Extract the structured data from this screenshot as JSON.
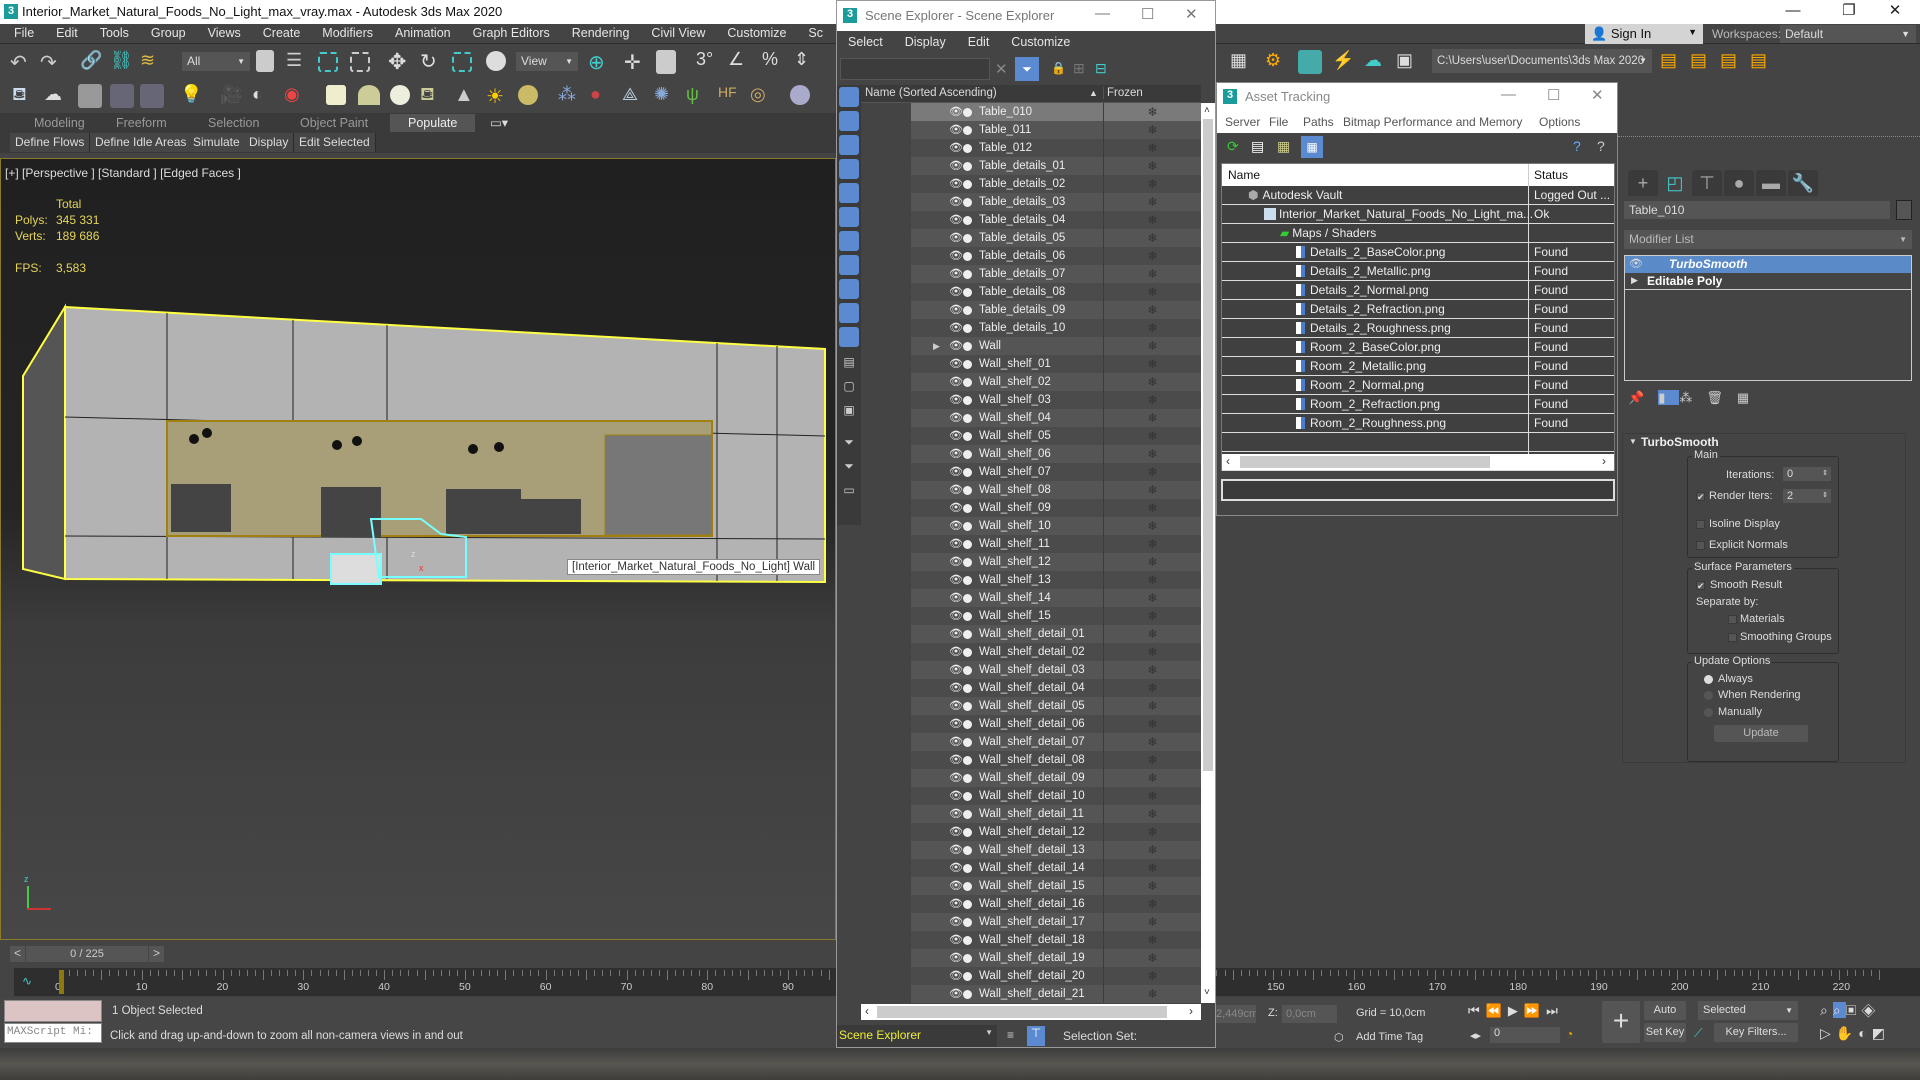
{
  "app": {
    "title": "Interior_Market_Natural_Foods_No_Light_max_vray.max - Autodesk 3ds Max 2020",
    "window_controls": {
      "minimize": "—",
      "restore": "❐",
      "close": "✕"
    }
  },
  "menubar": [
    "File",
    "Edit",
    "Tools",
    "Group",
    "Views",
    "Create",
    "Modifiers",
    "Animation",
    "Graph Editors",
    "Rendering",
    "Civil View",
    "Customize",
    "Sc"
  ],
  "toolbar": {
    "selection_filter": "All",
    "ref_coord": "View",
    "project_path": "C:\\Users\\user\\Documents\\3ds Max 2020",
    "sign_in": "Sign In",
    "workspaces_label": "Workspaces:",
    "workspace": "Default"
  },
  "ribbon": {
    "tabs": [
      "Modeling",
      "Freeform",
      "Selection",
      "Object Paint",
      "Populate"
    ],
    "active_tab": "Populate",
    "subtabs": [
      "Define Flows",
      "Define Idle Areas",
      "Simulate",
      "Display",
      "Edit Selected"
    ]
  },
  "viewport": {
    "label": "[+] [Perspective ] [Standard ] [Edged Faces ]",
    "stats_header": "Total",
    "polys_label": "Polys:",
    "polys": "345 331",
    "verts_label": "Verts:",
    "verts": "189 686",
    "fps_label": "FPS:",
    "fps": "3,583",
    "tooltip": "[Interior_Market_Natural_Foods_No_Light] Wall",
    "axis_z": "z",
    "axis_x": "x",
    "axis_y": "y"
  },
  "scene_explorer": {
    "title": "Scene Explorer - Scene Explorer",
    "menu": [
      "Select",
      "Display",
      "Edit",
      "Customize"
    ],
    "col_name": "Name (Sorted Ascending)",
    "col_frozen": "Frozen",
    "rows": [
      "Table_010",
      "Table_011",
      "Table_012",
      "Table_details_01",
      "Table_details_02",
      "Table_details_03",
      "Table_details_04",
      "Table_details_05",
      "Table_details_06",
      "Table_details_07",
      "Table_details_08",
      "Table_details_09",
      "Table_details_10",
      "Wall",
      "Wall_shelf_01",
      "Wall_shelf_02",
      "Wall_shelf_03",
      "Wall_shelf_04",
      "Wall_shelf_05",
      "Wall_shelf_06",
      "Wall_shelf_07",
      "Wall_shelf_08",
      "Wall_shelf_09",
      "Wall_shelf_10",
      "Wall_shelf_11",
      "Wall_shelf_12",
      "Wall_shelf_13",
      "Wall_shelf_14",
      "Wall_shelf_15",
      "Wall_shelf_detail_01",
      "Wall_shelf_detail_02",
      "Wall_shelf_detail_03",
      "Wall_shelf_detail_04",
      "Wall_shelf_detail_05",
      "Wall_shelf_detail_06",
      "Wall_shelf_detail_07",
      "Wall_shelf_detail_08",
      "Wall_shelf_detail_09",
      "Wall_shelf_detail_10",
      "Wall_shelf_detail_11",
      "Wall_shelf_detail_12",
      "Wall_shelf_detail_13",
      "Wall_shelf_detail_14",
      "Wall_shelf_detail_15",
      "Wall_shelf_detail_16",
      "Wall_shelf_detail_17",
      "Wall_shelf_detail_18",
      "Wall_shelf_detail_19",
      "Wall_shelf_detail_20",
      "Wall_shelf_detail_21"
    ],
    "selected": "Table_010",
    "expandable": "Wall",
    "footer_dropdown": "Scene Explorer",
    "selection_set_label": "Selection Set:"
  },
  "asset_tracking": {
    "title": "Asset Tracking",
    "menu": [
      "Server",
      "File",
      "Paths",
      "Bitmap Performance and Memory",
      "Options"
    ],
    "col_name": "Name",
    "col_status": "Status",
    "rows": [
      {
        "name": "Autodesk Vault",
        "status": "Logged Out ...",
        "level": 0,
        "icon": "vault-icon"
      },
      {
        "name": "Interior_Market_Natural_Foods_No_Light_ma...",
        "status": "Ok",
        "level": 1,
        "icon": "max-file-icon"
      },
      {
        "name": "Maps / Shaders",
        "status": "",
        "level": 2,
        "icon": "maps-icon"
      },
      {
        "name": "Details_2_BaseColor.png",
        "status": "Found",
        "level": 3,
        "icon": "image-file-icon"
      },
      {
        "name": "Details_2_Metallic.png",
        "status": "Found",
        "level": 3,
        "icon": "image-file-icon"
      },
      {
        "name": "Details_2_Normal.png",
        "status": "Found",
        "level": 3,
        "icon": "image-file-icon"
      },
      {
        "name": "Details_2_Refraction.png",
        "status": "Found",
        "level": 3,
        "icon": "image-file-icon"
      },
      {
        "name": "Details_2_Roughness.png",
        "status": "Found",
        "level": 3,
        "icon": "image-file-icon"
      },
      {
        "name": "Room_2_BaseColor.png",
        "status": "Found",
        "level": 3,
        "icon": "image-file-icon"
      },
      {
        "name": "Room_2_Metallic.png",
        "status": "Found",
        "level": 3,
        "icon": "image-file-icon"
      },
      {
        "name": "Room_2_Normal.png",
        "status": "Found",
        "level": 3,
        "icon": "image-file-icon"
      },
      {
        "name": "Room_2_Refraction.png",
        "status": "Found",
        "level": 3,
        "icon": "image-file-icon"
      },
      {
        "name": "Room_2_Roughness.png",
        "status": "Found",
        "level": 3,
        "icon": "image-file-icon"
      }
    ]
  },
  "command_panel": {
    "object_name": "Table_010",
    "modifier_list": "Modifier List",
    "stack": [
      {
        "name": "TurboSmooth",
        "selected": true
      },
      {
        "name": "Editable Poly",
        "selected": false
      }
    ],
    "rollout_title": "TurboSmooth",
    "main_group": "Main",
    "iterations_label": "Iterations:",
    "iterations": "0",
    "render_iters_label": "Render Iters:",
    "render_iters": "2",
    "render_iters_checked": true,
    "isoline_label": "Isoline Display",
    "isoline_checked": false,
    "explicit_normals_label": "Explicit Normals",
    "explicit_normals_checked": false,
    "surface_group": "Surface Parameters",
    "smooth_result_label": "Smooth Result",
    "smooth_result_checked": true,
    "separate_by_label": "Separate by:",
    "materials_label": "Materials",
    "materials_checked": false,
    "smoothing_groups_label": "Smoothing Groups",
    "smoothing_groups_checked": false,
    "update_group": "Update Options",
    "update_options": [
      "Always",
      "When Rendering",
      "Manually"
    ],
    "update_selected": "Always",
    "update_button": "Update"
  },
  "timeline": {
    "frame_display": "0 / 225",
    "prev": "<",
    "next": ">",
    "start": 0,
    "end": 225,
    "current": 0,
    "label_step": 10
  },
  "status": {
    "maxscript_placeholder": "MAXScript Mi:",
    "selection_info": "1 Object Selected",
    "prompt": "Click and drag up-and-down to zoom all non-camera views in and out",
    "x_value": "2,449cm",
    "z_label": "Z:",
    "z_value": "0,0cm",
    "grid": "Grid = 10,0cm",
    "add_time_tag": "Add Time Tag",
    "auto_key": "Auto Key",
    "set_key": "Set Key",
    "key_mode": "Selected",
    "key_filters": "Key Filters...",
    "frame_input": "0"
  }
}
